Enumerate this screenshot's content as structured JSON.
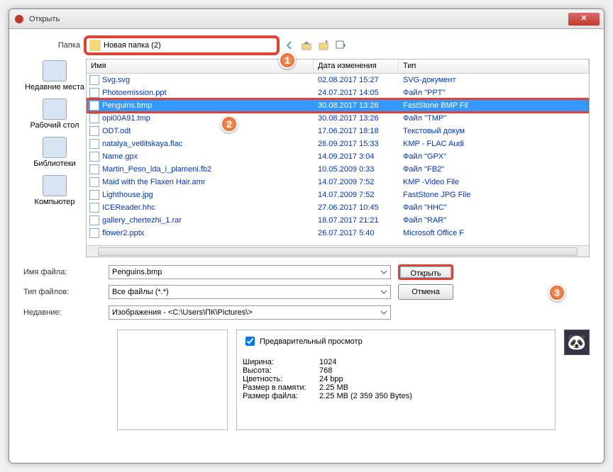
{
  "window": {
    "title": "Открыть"
  },
  "toprow": {
    "label": "Папка",
    "folder": "Новая папка (2)"
  },
  "sidebar": [
    {
      "label": "Недавние места"
    },
    {
      "label": "Рабочий стол"
    },
    {
      "label": "Библиотеки"
    },
    {
      "label": "Компьютер"
    }
  ],
  "columns": {
    "name": "Имя",
    "date": "Дата изменения",
    "type": "Тип"
  },
  "files": [
    {
      "name": "Svg.svg",
      "date": "02.08.2017 15:27",
      "type": "SVG-документ",
      "sel": false
    },
    {
      "name": "Photoemission.ppt",
      "date": "24.07.2017 14:05",
      "type": "Файл \"PPT\"",
      "sel": false
    },
    {
      "name": "Penguins.bmp",
      "date": "30.08.2017 13:26",
      "type": "FastStone BMP Fil",
      "sel": true
    },
    {
      "name": "opi00A91.tmp",
      "date": "30.08.2017 13:26",
      "type": "Файл \"TMP\"",
      "sel": false
    },
    {
      "name": "ODT.odt",
      "date": "17.06.2017 18:18",
      "type": "Текстовый докум",
      "sel": false
    },
    {
      "name": "natalya_vetlitskaya.flac",
      "date": "26.09.2017 15:33",
      "type": "KMP - FLAC Audi",
      "sel": false
    },
    {
      "name": "Name.gpx",
      "date": "14.09.2017 3:04",
      "type": "Файл \"GPX\"",
      "sel": false
    },
    {
      "name": "Martin_Pesn_lda_i_plameni.fb2",
      "date": "10.05.2009 0:33",
      "type": "Файл \"FB2\"",
      "sel": false
    },
    {
      "name": "Maid with the Flaxen Hair.amr",
      "date": "14.07.2009 7:52",
      "type": "KMP -Video File",
      "sel": false
    },
    {
      "name": "Lighthouse.jpg",
      "date": "14.07.2009 7:52",
      "type": "FastStone JPG File",
      "sel": false
    },
    {
      "name": "ICEReader.hhc",
      "date": "27.06.2017 10:45",
      "type": "Файл \"HHC\"",
      "sel": false
    },
    {
      "name": "gallery_chertezhi_1.rar",
      "date": "18.07.2017 21:21",
      "type": "Файл \"RAR\"",
      "sel": false
    },
    {
      "name": "flower2.pptx",
      "date": "26.07.2017 5:40",
      "type": "Microsoft Office F",
      "sel": false
    }
  ],
  "form": {
    "filename_label": "Имя файла:",
    "filename_value": "Penguins.bmp",
    "filetype_label": "Тип файлов:",
    "filetype_value": "Все файлы (*.*)",
    "recent_label": "Недавние:",
    "recent_value": "Изображения  -  <C:\\Users\\ПК\\Pictures\\>",
    "open": "Открыть",
    "cancel": "Отмена"
  },
  "preview": {
    "checkbox": "Предварительный просмотр",
    "lines": [
      {
        "k": "Ширина:",
        "v": "1024"
      },
      {
        "k": "Высота:",
        "v": "768"
      },
      {
        "k": "Цветность:",
        "v": "24 bpp"
      },
      {
        "k": "Размер в памяти:",
        "v": "2.25 MB"
      },
      {
        "k": "Размер файла:",
        "v": "2.25 MB (2 359 350 Bytes)"
      }
    ]
  },
  "badges": {
    "one": "1",
    "two": "2",
    "three": "3"
  }
}
